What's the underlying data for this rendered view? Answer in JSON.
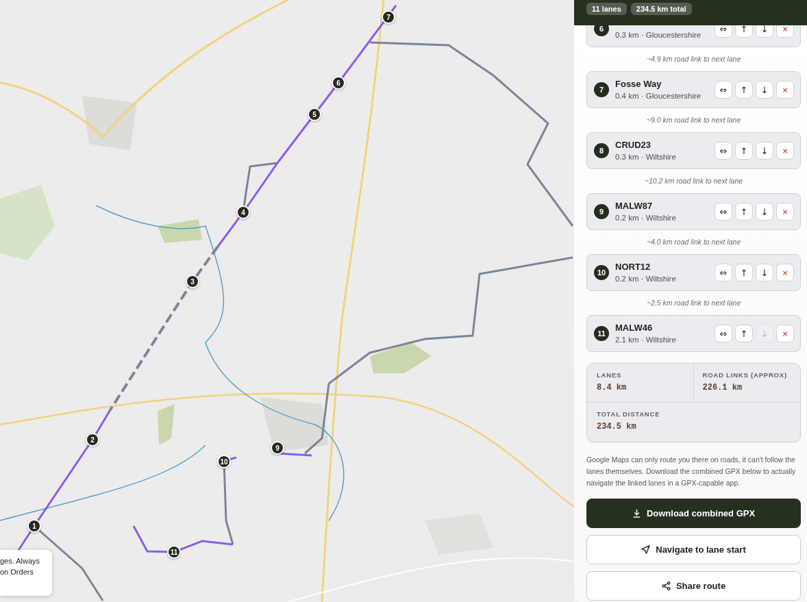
{
  "map": {
    "kind": "picture",
    "markers": [
      {
        "label": "1"
      },
      {
        "label": "2"
      },
      {
        "label": "3"
      },
      {
        "label": "4"
      },
      {
        "label": "5"
      },
      {
        "label": "6"
      },
      {
        "label": "7"
      },
      {
        "label": "9"
      },
      {
        "label": "10"
      },
      {
        "label": "11"
      }
    ],
    "popup": {
      "lines": [
        "ges. Always",
        "on Orders"
      ]
    }
  },
  "panel": {
    "chips": [
      "11 lanes",
      "234.5 km total"
    ],
    "lanes": [
      {
        "number": "6",
        "meta": "0.3 km · Gloucestershire",
        "link": "~4.9 km road link to next lane",
        "actions": [
          {
            "kind": "reverse",
            "label": "⇔",
            "disabled": false
          },
          {
            "kind": "up",
            "label": "↑",
            "disabled": false
          },
          {
            "kind": "down",
            "label": "↓",
            "disabled": false
          },
          {
            "kind": "remove",
            "label": "×",
            "disabled": false
          }
        ]
      },
      {
        "number": "7",
        "title": "Fosse Way",
        "meta": "0.4 km · Gloucestershire",
        "link": "~9.0 km road link to next lane",
        "actions": [
          {
            "kind": "reverse",
            "label": "⇔",
            "disabled": false
          },
          {
            "kind": "up",
            "label": "↑",
            "disabled": false
          },
          {
            "kind": "down",
            "label": "↓",
            "disabled": false
          },
          {
            "kind": "remove",
            "label": "×",
            "disabled": false
          }
        ]
      },
      {
        "number": "8",
        "title": "CRUD23",
        "meta": "0.3 km · Wiltshire",
        "link": "~10.2 km road link to next lane",
        "actions": [
          {
            "kind": "reverse",
            "label": "⇔",
            "disabled": false
          },
          {
            "kind": "up",
            "label": "↑",
            "disabled": false
          },
          {
            "kind": "down",
            "label": "↓",
            "disabled": false
          },
          {
            "kind": "remove",
            "label": "×",
            "disabled": false
          }
        ]
      },
      {
        "number": "9",
        "title": "MALW87",
        "meta": "0.2 km · Wiltshire",
        "link": "~4.0 km road link to next lane",
        "actions": [
          {
            "kind": "reverse",
            "label": "⇔",
            "disabled": false
          },
          {
            "kind": "up",
            "label": "↑",
            "disabled": false
          },
          {
            "kind": "down",
            "label": "↓",
            "disabled": false
          },
          {
            "kind": "remove",
            "label": "×",
            "disabled": false
          }
        ]
      },
      {
        "number": "10",
        "title": "NORT12",
        "meta": "0.2 km · Wiltshire",
        "link": "~2.5 km road link to next lane",
        "actions": [
          {
            "kind": "reverse",
            "label": "⇔",
            "disabled": false
          },
          {
            "kind": "up",
            "label": "↑",
            "disabled": false
          },
          {
            "kind": "down",
            "label": "↓",
            "disabled": false
          },
          {
            "kind": "remove",
            "label": "×",
            "disabled": false
          }
        ]
      },
      {
        "number": "11",
        "title": "MALW46",
        "meta": "2.1 km · Wiltshire",
        "actions": [
          {
            "kind": "reverse",
            "label": "⇔",
            "disabled": false
          },
          {
            "kind": "up",
            "label": "↑",
            "disabled": false
          },
          {
            "kind": "down",
            "label": "↓",
            "disabled": true
          },
          {
            "kind": "remove",
            "label": "×",
            "disabled": false
          }
        ]
      }
    ],
    "summary": [
      {
        "label": "LANES",
        "value": "8.4 km"
      },
      {
        "label": "ROAD LINKS (APPROX)",
        "value": "226.1 km"
      },
      {
        "label": "TOTAL DISTANCE",
        "value": "234.5 km"
      }
    ],
    "note": "Google Maps can only route you there on roads, it can't follow the lanes themselves. Download the combined GPX below to actually navigate the linked lanes in a GPX-capable app.",
    "buttons": [
      {
        "kind": "download",
        "label": "Download combined GPX"
      },
      {
        "kind": "navigate",
        "label": "Navigate to lane start"
      },
      {
        "kind": "share",
        "label": "Share route"
      }
    ]
  }
}
